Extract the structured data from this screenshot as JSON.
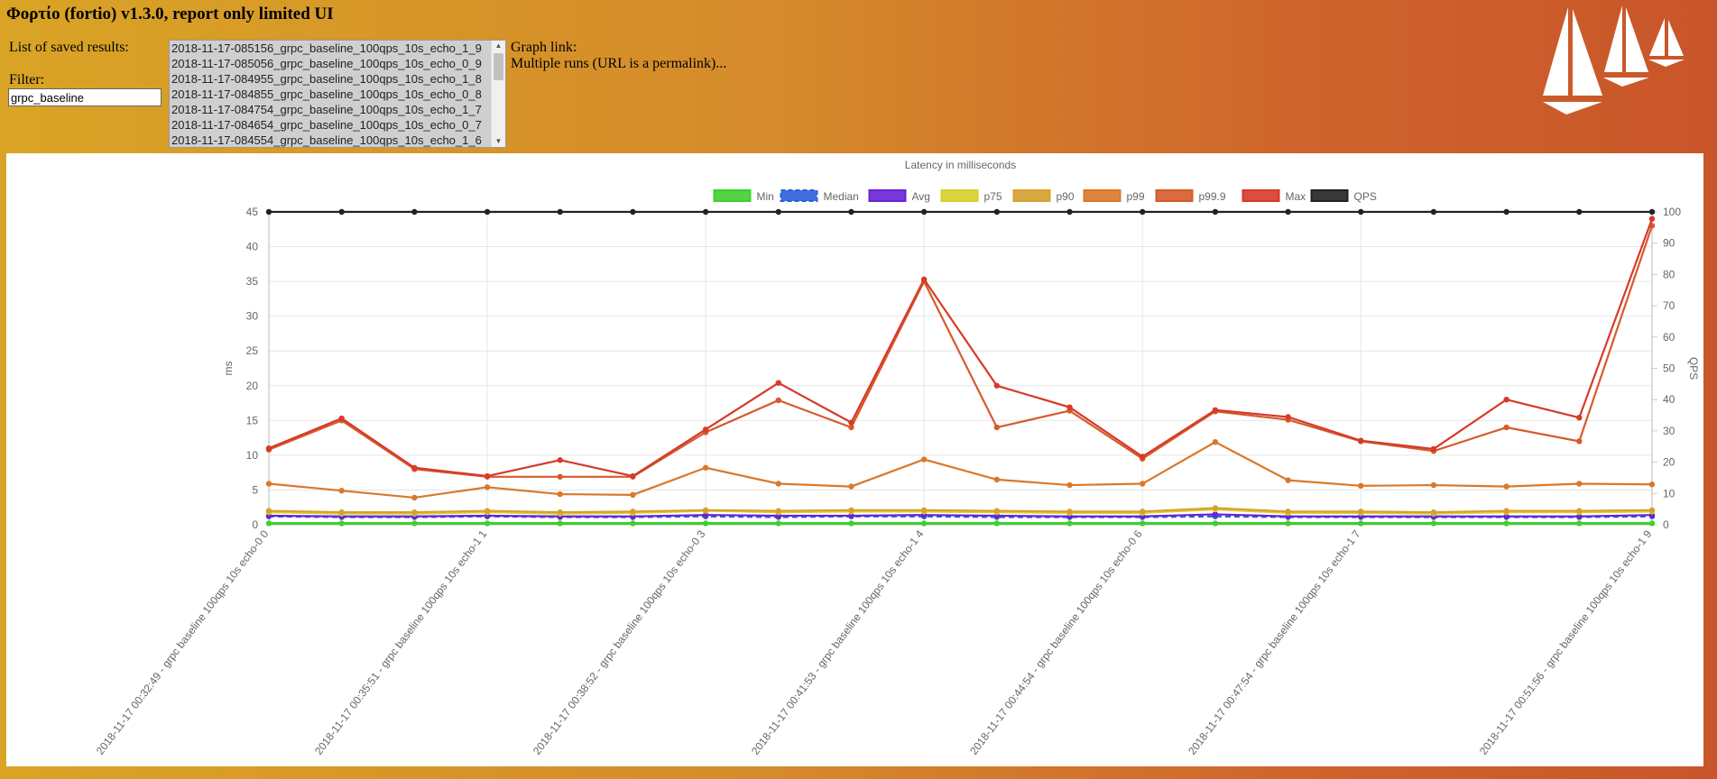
{
  "header": {
    "title": "Φορτίο (fortio) v1.3.0, report only limited UI"
  },
  "results": {
    "list_label": "List of saved results:",
    "items": [
      "2018-11-17-085156_grpc_baseline_100qps_10s_echo_1_9",
      "2018-11-17-085056_grpc_baseline_100qps_10s_echo_0_9",
      "2018-11-17-084955_grpc_baseline_100qps_10s_echo_1_8",
      "2018-11-17-084855_grpc_baseline_100qps_10s_echo_0_8",
      "2018-11-17-084754_grpc_baseline_100qps_10s_echo_1_7",
      "2018-11-17-084654_grpc_baseline_100qps_10s_echo_0_7",
      "2018-11-17-084554_grpc_baseline_100qps_10s_echo_1_6"
    ]
  },
  "filter": {
    "label": "Filter:",
    "value": "grpc_baseline"
  },
  "graph_link": {
    "label": "Graph link:",
    "text": "Multiple runs (URL is a permalink)..."
  },
  "chart_data": {
    "type": "line",
    "title": "Latency in milliseconds",
    "ylabel": "ms",
    "y2label": "QPS",
    "ylim": [
      0,
      45
    ],
    "y2lim": [
      0,
      100
    ],
    "yticks": [
      0,
      5,
      10,
      15,
      20,
      25,
      30,
      35,
      40,
      45
    ],
    "y2ticks": [
      0,
      10,
      20,
      30,
      40,
      50,
      60,
      70,
      80,
      90,
      100
    ],
    "grid": true,
    "legend_position": "top",
    "x_tick_labels": [
      "2018-11-17 00:32:49 - grpc baseline 100qps 10s echo-0 0",
      "2018-11-17 00:35:51 - grpc baseline 100qps 10s echo-1 1",
      "2018-11-17 00:38:52 - grpc baseline 100qps 10s echo-0 3",
      "2018-11-17 00:41:53 - grpc baseline 100qps 10s echo-1 4",
      "2018-11-17 00:44:54 - grpc baseline 100qps 10s echo-0 6",
      "2018-11-17 00:47:54 - grpc baseline 100qps 10s echo-1 7",
      "2018-11-17 00:51:56 - grpc baseline 100qps 10s echo-1 9"
    ],
    "x_tick_label_positions": [
      0,
      3,
      6,
      9,
      12,
      15,
      19
    ],
    "num_points": 20,
    "series": [
      {
        "name": "Min",
        "color": "#3fcf2f",
        "axis": "left",
        "values": [
          0.2,
          0.2,
          0.2,
          0.2,
          0.2,
          0.2,
          0.2,
          0.2,
          0.2,
          0.2,
          0.2,
          0.2,
          0.2,
          0.2,
          0.2,
          0.2,
          0.2,
          0.2,
          0.2,
          0.2
        ]
      },
      {
        "name": "Median",
        "color": "#2b5fd9",
        "axis": "left",
        "dashed": true,
        "values": [
          1.2,
          1.1,
          1.1,
          1.2,
          1.1,
          1.1,
          1.2,
          1.1,
          1.2,
          1.2,
          1.1,
          1.1,
          1.1,
          1.2,
          1.1,
          1.1,
          1.1,
          1.1,
          1.1,
          1.2
        ]
      },
      {
        "name": "Avg",
        "color": "#6a22d6",
        "axis": "left",
        "values": [
          1.3,
          1.2,
          1.2,
          1.3,
          1.2,
          1.2,
          1.4,
          1.3,
          1.3,
          1.4,
          1.3,
          1.2,
          1.2,
          1.5,
          1.2,
          1.2,
          1.2,
          1.2,
          1.2,
          1.4
        ]
      },
      {
        "name": "p75",
        "color": "#d8cf2b",
        "axis": "left",
        "values": [
          1.8,
          1.6,
          1.6,
          1.8,
          1.6,
          1.7,
          2.0,
          1.8,
          1.9,
          1.9,
          1.8,
          1.7,
          1.7,
          2.2,
          1.7,
          1.7,
          1.6,
          1.8,
          1.8,
          1.9
        ]
      },
      {
        "name": "p90",
        "color": "#d6a02f",
        "axis": "left",
        "values": [
          2.0,
          1.8,
          1.8,
          2.0,
          1.8,
          1.9,
          2.1,
          2.0,
          2.1,
          2.1,
          2.0,
          1.9,
          1.9,
          2.4,
          1.9,
          1.9,
          1.8,
          2.0,
          2.0,
          2.1
        ]
      },
      {
        "name": "p99",
        "color": "#d9782b",
        "axis": "left",
        "values": [
          5.9,
          4.9,
          3.9,
          5.4,
          4.4,
          4.3,
          8.2,
          5.9,
          5.5,
          9.4,
          6.5,
          5.7,
          5.9,
          11.9,
          6.4,
          5.6,
          5.7,
          5.5,
          5.9,
          5.8
        ]
      },
      {
        "name": "p99.9",
        "color": "#d65a2a",
        "axis": "left",
        "values": [
          10.8,
          15.0,
          8.0,
          6.9,
          6.9,
          6.9,
          13.3,
          17.9,
          14.0,
          35.0,
          14.0,
          16.4,
          9.5,
          16.3,
          15.1,
          12.0,
          10.6,
          14.0,
          12.0,
          43.0
        ]
      },
      {
        "name": "Max",
        "color": "#d63a2a",
        "axis": "left",
        "values": [
          11.0,
          15.3,
          8.2,
          7.0,
          9.3,
          7.0,
          13.7,
          20.4,
          14.7,
          35.3,
          20.0,
          16.9,
          9.8,
          16.5,
          15.5,
          12.1,
          10.9,
          18.0,
          15.4,
          44.0
        ]
      },
      {
        "name": "QPS",
        "color": "#222222",
        "axis": "right",
        "values": [
          100,
          100,
          100,
          100,
          100,
          100,
          100,
          100,
          100,
          100,
          100,
          100,
          100,
          100,
          100,
          100,
          100,
          100,
          100,
          100
        ]
      }
    ]
  }
}
